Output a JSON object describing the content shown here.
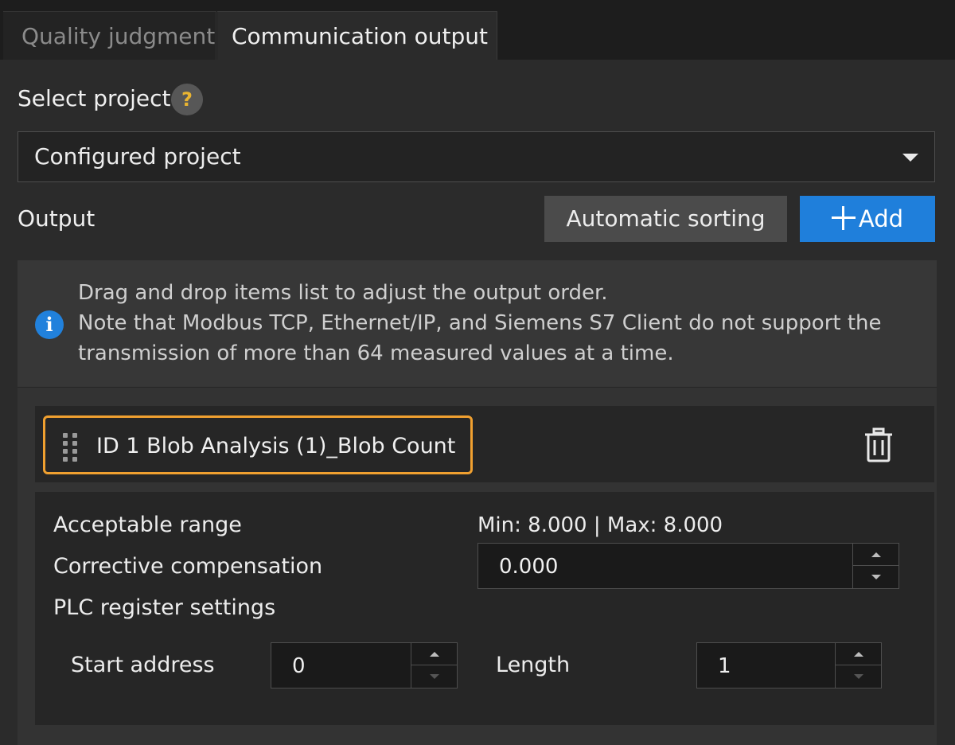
{
  "tabs": {
    "quality": "Quality judgment",
    "communication": "Communication output"
  },
  "project": {
    "label": "Select project",
    "help": "?",
    "selected": "Configured project"
  },
  "output": {
    "label": "Output",
    "sort_button": "Automatic sorting",
    "add_button": "Add"
  },
  "notice": {
    "line1": "Drag and drop items list to adjust the output order.",
    "line2": "Note that Modbus TCP, Ethernet/IP, and Siemens S7 Client do not support the",
    "line3": "transmission of more than 64 measured values at a time."
  },
  "item": {
    "label": "ID 1  Blob Analysis (1)_Blob Count"
  },
  "details": {
    "range_label": "Acceptable range",
    "range_value": "Min: 8.000 | Max: 8.000",
    "compensation_label": "Corrective compensation",
    "compensation_value": "0.000",
    "plc_label": "PLC register settings",
    "start_label": "Start address",
    "start_value": "0",
    "length_label": "Length",
    "length_value": "1"
  },
  "colors": {
    "accent": "#1f7fdb",
    "highlight": "#f0a030",
    "help": "#e9b431"
  }
}
